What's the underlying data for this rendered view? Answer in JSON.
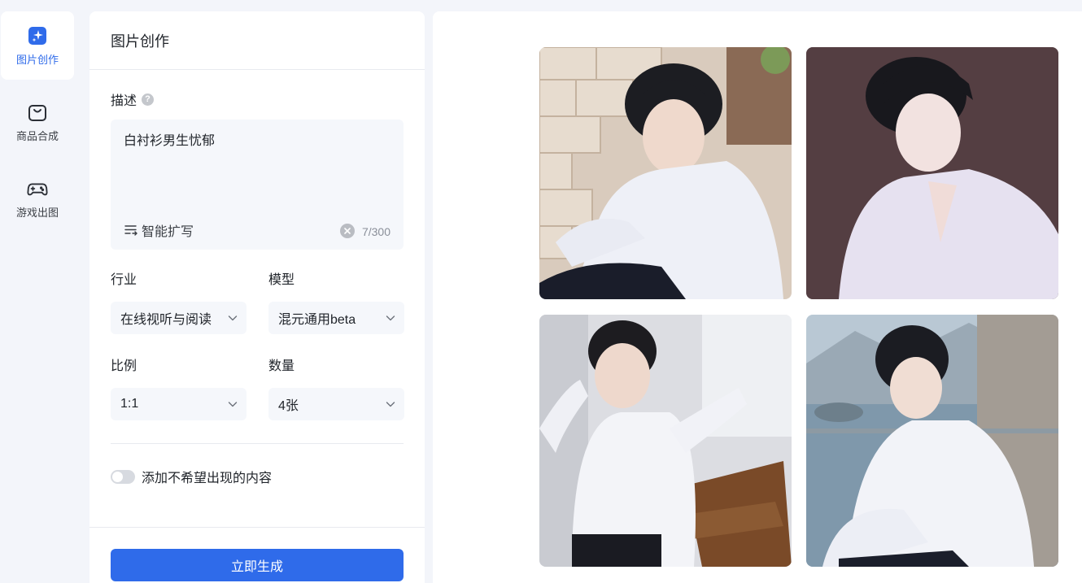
{
  "nav": {
    "items": [
      {
        "label": "图片创作",
        "icon": "sparkle-icon",
        "active": true
      },
      {
        "label": "商品合成",
        "icon": "shopping-bag-icon",
        "active": false
      },
      {
        "label": "游戏出图",
        "icon": "gamepad-icon",
        "active": false
      }
    ]
  },
  "panel": {
    "title": "图片创作",
    "description": {
      "label": "描述",
      "value": "白衬衫男生忧郁",
      "smart_expand": "智能扩写",
      "count": "7/300"
    },
    "industry": {
      "label": "行业",
      "value": "在线视听与阅读"
    },
    "model": {
      "label": "模型",
      "value": "混元通用beta"
    },
    "ratio": {
      "label": "比例",
      "value": "1:1"
    },
    "quantity": {
      "label": "数量",
      "value": "4张"
    },
    "negative_toggle": {
      "label": "添加不希望出现的内容",
      "on": false
    },
    "generate_button": "立即生成"
  },
  "colors": {
    "accent": "#2f6bea",
    "background": "#f3f5fa"
  },
  "results": {
    "images": [
      {
        "name": "result-image-1"
      },
      {
        "name": "result-image-2"
      },
      {
        "name": "result-image-3"
      },
      {
        "name": "result-image-4"
      }
    ]
  }
}
